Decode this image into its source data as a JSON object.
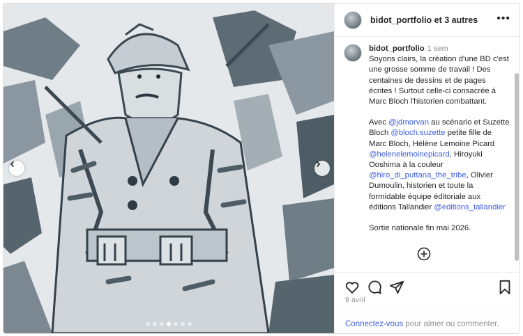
{
  "header": {
    "title": "bidot_portfolio et 3 autres",
    "more_icon": "more-horizontal-icon"
  },
  "caption": {
    "username": "bidot_portfolio",
    "time": "1 sem",
    "paragraph1": "Soyons clairs, la création d'une BD c'est une grosse somme de travail ! Des centaines de dessins et de pages écrites ! Surtout celle-ci consacrée à Marc Bloch l'historien combattant.",
    "p2_text1": "Avec ",
    "mention1": "@jdmorvan",
    "p2_text2": " au scénario et Suzette Bloch ",
    "mention2": "@bloch.suzette",
    "p2_text3": " petite fille de Marc Bloch, Hélène Lemoine Picard ",
    "mention3": "@helenelemoinepicard",
    "p2_text4": ", Hiroyuki Ooshima à la couleur ",
    "mention4": "@hiro_di_puttana_the_tribe",
    "p2_text5": ", Olivier Dumoulin, historien et toute la formidable équipe éditoriale aux éditions Tallandier ",
    "mention5": "@editions_tallandier",
    "paragraph3": "Sortie nationale fin mai 2026."
  },
  "carousel": {
    "dot_count": 7,
    "active_index": 3
  },
  "post": {
    "date": "9 avril"
  },
  "footer": {
    "login_link": "Connectez-vous",
    "login_text": " pour aimer ou commenter."
  },
  "icons": [
    "heart-icon",
    "comment-icon",
    "share-icon",
    "bookmark-icon",
    "plus-circle-icon",
    "chevron-left-icon",
    "chevron-right-icon"
  ],
  "colors": {
    "link": "#3d5de0",
    "muted": "#8e8e8e",
    "text": "#262626"
  }
}
